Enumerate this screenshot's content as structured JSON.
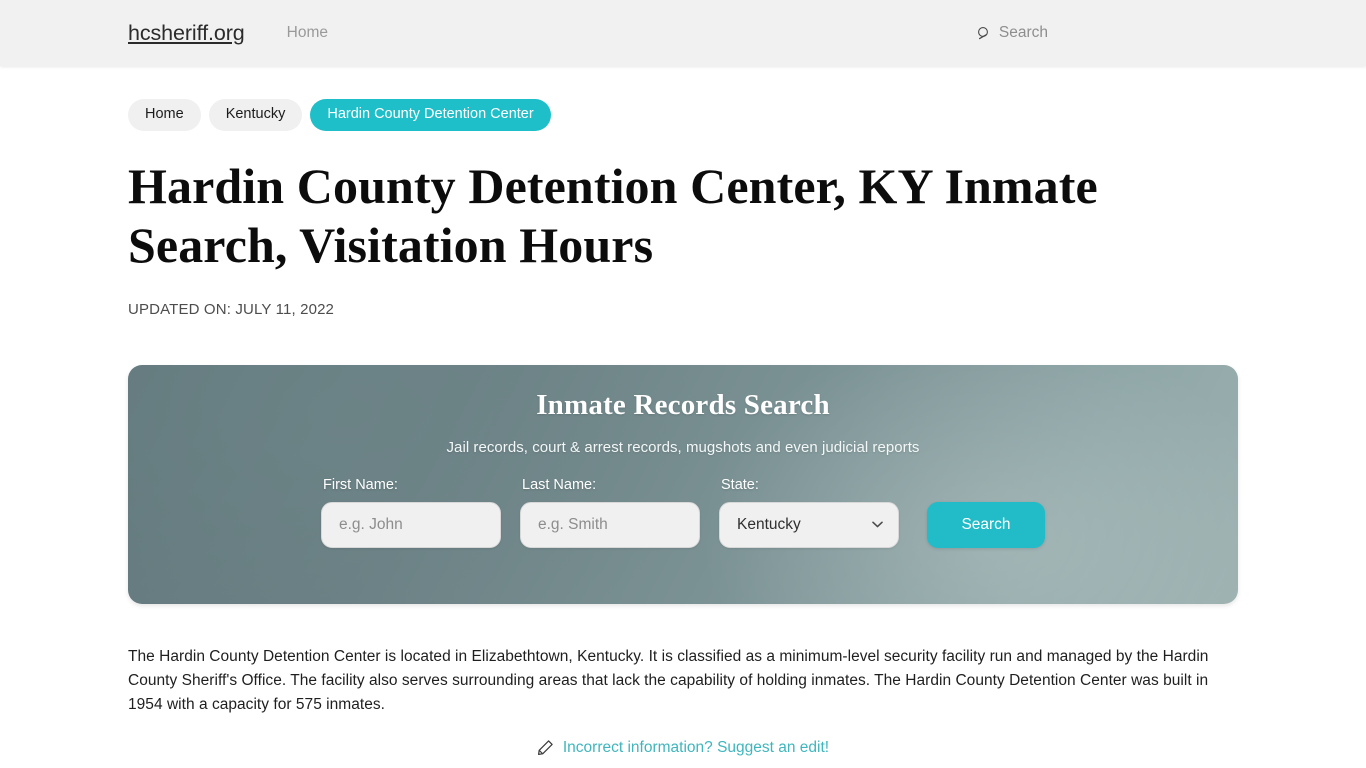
{
  "header": {
    "brand": "hcsheriff.org",
    "nav": [
      {
        "label": "Home",
        "name": "nav-home"
      }
    ],
    "search": {
      "label": "Search",
      "icon": "search-icon"
    }
  },
  "breadcrumb": {
    "items": [
      {
        "label": "Home",
        "active": false
      },
      {
        "label": "Kentucky",
        "active": false
      },
      {
        "label": "Hardin County Detention Center",
        "active": true
      }
    ]
  },
  "main": {
    "title": "Hardin County Detention Center, KY Inmate Search, Visitation Hours",
    "updated": "UPDATED ON: JULY 11, 2022",
    "body_paragraph": "The Hardin County Detention Center is located in Elizabethtown, Kentucky. It is classified as a minimum-level security facility run and managed by the Hardin County Sheriff's Office. The facility also serves surrounding areas that lack the capability of holding inmates. The Hardin County Detention Center was built in 1954 with a capacity for 575 inmates.",
    "suggest_edit": {
      "label": "Incorrect information? Suggest an edit!",
      "icon": "pencil-icon"
    }
  },
  "search_widget": {
    "title": "Inmate Records Search",
    "subtitle": "Jail records, court & arrest records, mugshots and even judicial reports",
    "fields": {
      "first_name": {
        "label": "First Name:",
        "placeholder": "e.g. John",
        "value": ""
      },
      "last_name": {
        "label": "Last Name:",
        "placeholder": "e.g. Smith",
        "value": ""
      },
      "state": {
        "label": "State:",
        "selected": "Kentucky",
        "options": [
          "Kentucky"
        ]
      }
    },
    "submit_label": "Search"
  },
  "colors": {
    "accent_teal": "#1ebfc9",
    "button_teal": "#22bcc8",
    "link_teal": "#3fb6bd",
    "header_bg": "#f1f1f1",
    "panel_dark": "#63797d",
    "panel_light": "#9db1b1",
    "input_bg": "#f0f0f0"
  }
}
